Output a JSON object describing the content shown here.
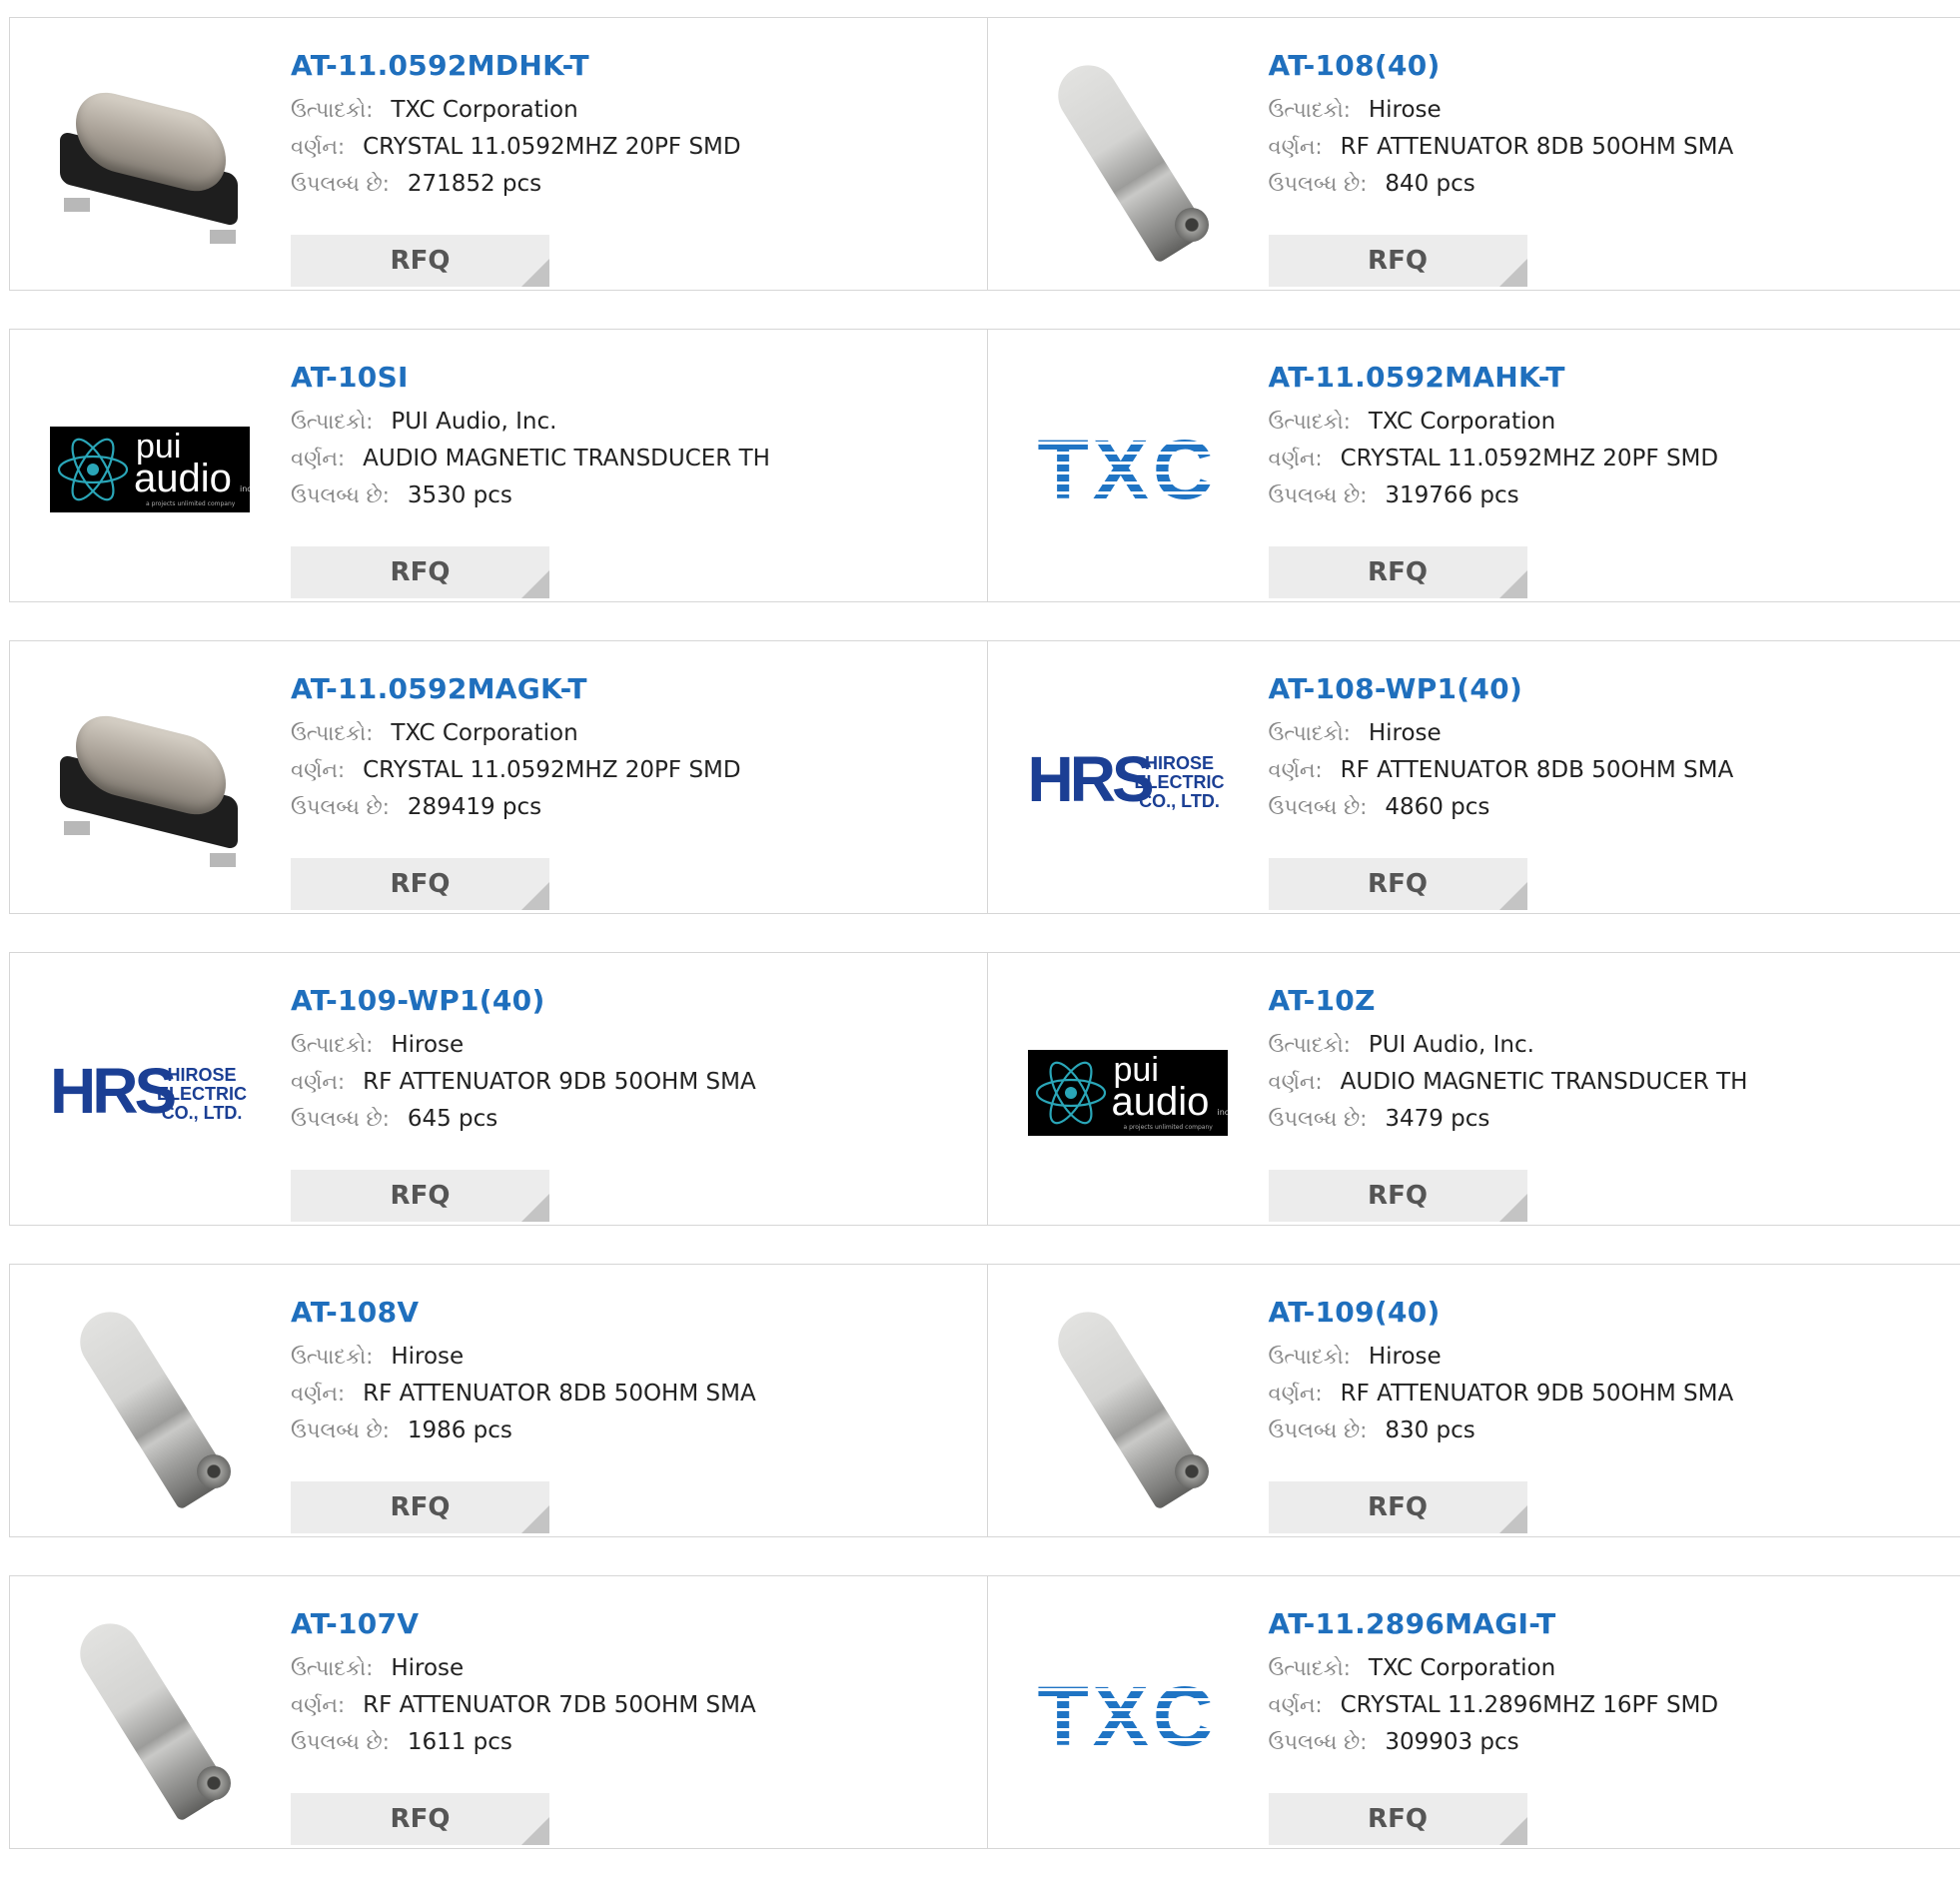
{
  "labels": {
    "manufacturer": "ઉત્પાદકો:",
    "description": "વર્ણન:",
    "available": "ઉપલબ્ધ છે:",
    "rfq": "RFQ"
  },
  "rows": [
    [
      {
        "part": "AT-11.0592MDHK-T",
        "manufacturer": "TXC Corporation",
        "description": "CRYSTAL 11.0592MHZ 20PF SMD",
        "available": "271852 pcs",
        "image": "crystal"
      },
      {
        "part": "AT-108(40)",
        "manufacturer": "Hirose",
        "description": "RF ATTENUATOR 8DB 50OHM SMA",
        "available": "840 pcs",
        "image": "attenuator"
      }
    ],
    [
      {
        "part": "AT-10SI",
        "manufacturer": "PUI Audio, Inc.",
        "description": "AUDIO MAGNETIC TRANSDUCER TH",
        "available": "3530 pcs",
        "image": "pui-logo"
      },
      {
        "part": "AT-11.0592MAHK-T",
        "manufacturer": "TXC Corporation",
        "description": "CRYSTAL 11.0592MHZ 20PF SMD",
        "available": "319766 pcs",
        "image": "txc-logo"
      }
    ],
    [
      {
        "part": "AT-11.0592MAGK-T",
        "manufacturer": "TXC Corporation",
        "description": "CRYSTAL 11.0592MHZ 20PF SMD",
        "available": "289419 pcs",
        "image": "crystal"
      },
      {
        "part": "AT-108-WP1(40)",
        "manufacturer": "Hirose",
        "description": "RF ATTENUATOR 8DB 50OHM SMA",
        "available": "4860 pcs",
        "image": "hrs-logo"
      }
    ],
    [
      {
        "part": "AT-109-WP1(40)",
        "manufacturer": "Hirose",
        "description": "RF ATTENUATOR 9DB 50OHM SMA",
        "available": "645 pcs",
        "image": "hrs-logo"
      },
      {
        "part": "AT-10Z",
        "manufacturer": "PUI Audio, Inc.",
        "description": "AUDIO MAGNETIC TRANSDUCER TH",
        "available": "3479 pcs",
        "image": "pui-logo"
      }
    ],
    [
      {
        "part": "AT-108V",
        "manufacturer": "Hirose",
        "description": "RF ATTENUATOR 8DB 50OHM SMA",
        "available": "1986 pcs",
        "image": "attenuator"
      },
      {
        "part": "AT-109(40)",
        "manufacturer": "Hirose",
        "description": "RF ATTENUATOR 9DB 50OHM SMA",
        "available": "830 pcs",
        "image": "attenuator"
      }
    ],
    [
      {
        "part": "AT-107V",
        "manufacturer": "Hirose",
        "description": "RF ATTENUATOR 7DB 50OHM SMA",
        "available": "1611 pcs",
        "image": "attenuator"
      },
      {
        "part": "AT-11.2896MAGI-T",
        "manufacturer": "TXC Corporation",
        "description": "CRYSTAL 11.2896MHZ 16PF SMD",
        "available": "309903 pcs",
        "image": "txc-logo"
      }
    ]
  ],
  "logos": {
    "pui_line1": "pui",
    "pui_line2": "audio",
    "pui_inc": "inc",
    "pui_tagline": "a projects unlimited company",
    "txc": "TXC",
    "hrs_big": "HRS",
    "hrs_small": [
      "HIROSE",
      "ELECTRIC",
      "CO., LTD."
    ]
  },
  "colors": {
    "part_link": "#1f6fbd",
    "rfq_bg": "#ececec",
    "border": "#d6d6d6"
  }
}
